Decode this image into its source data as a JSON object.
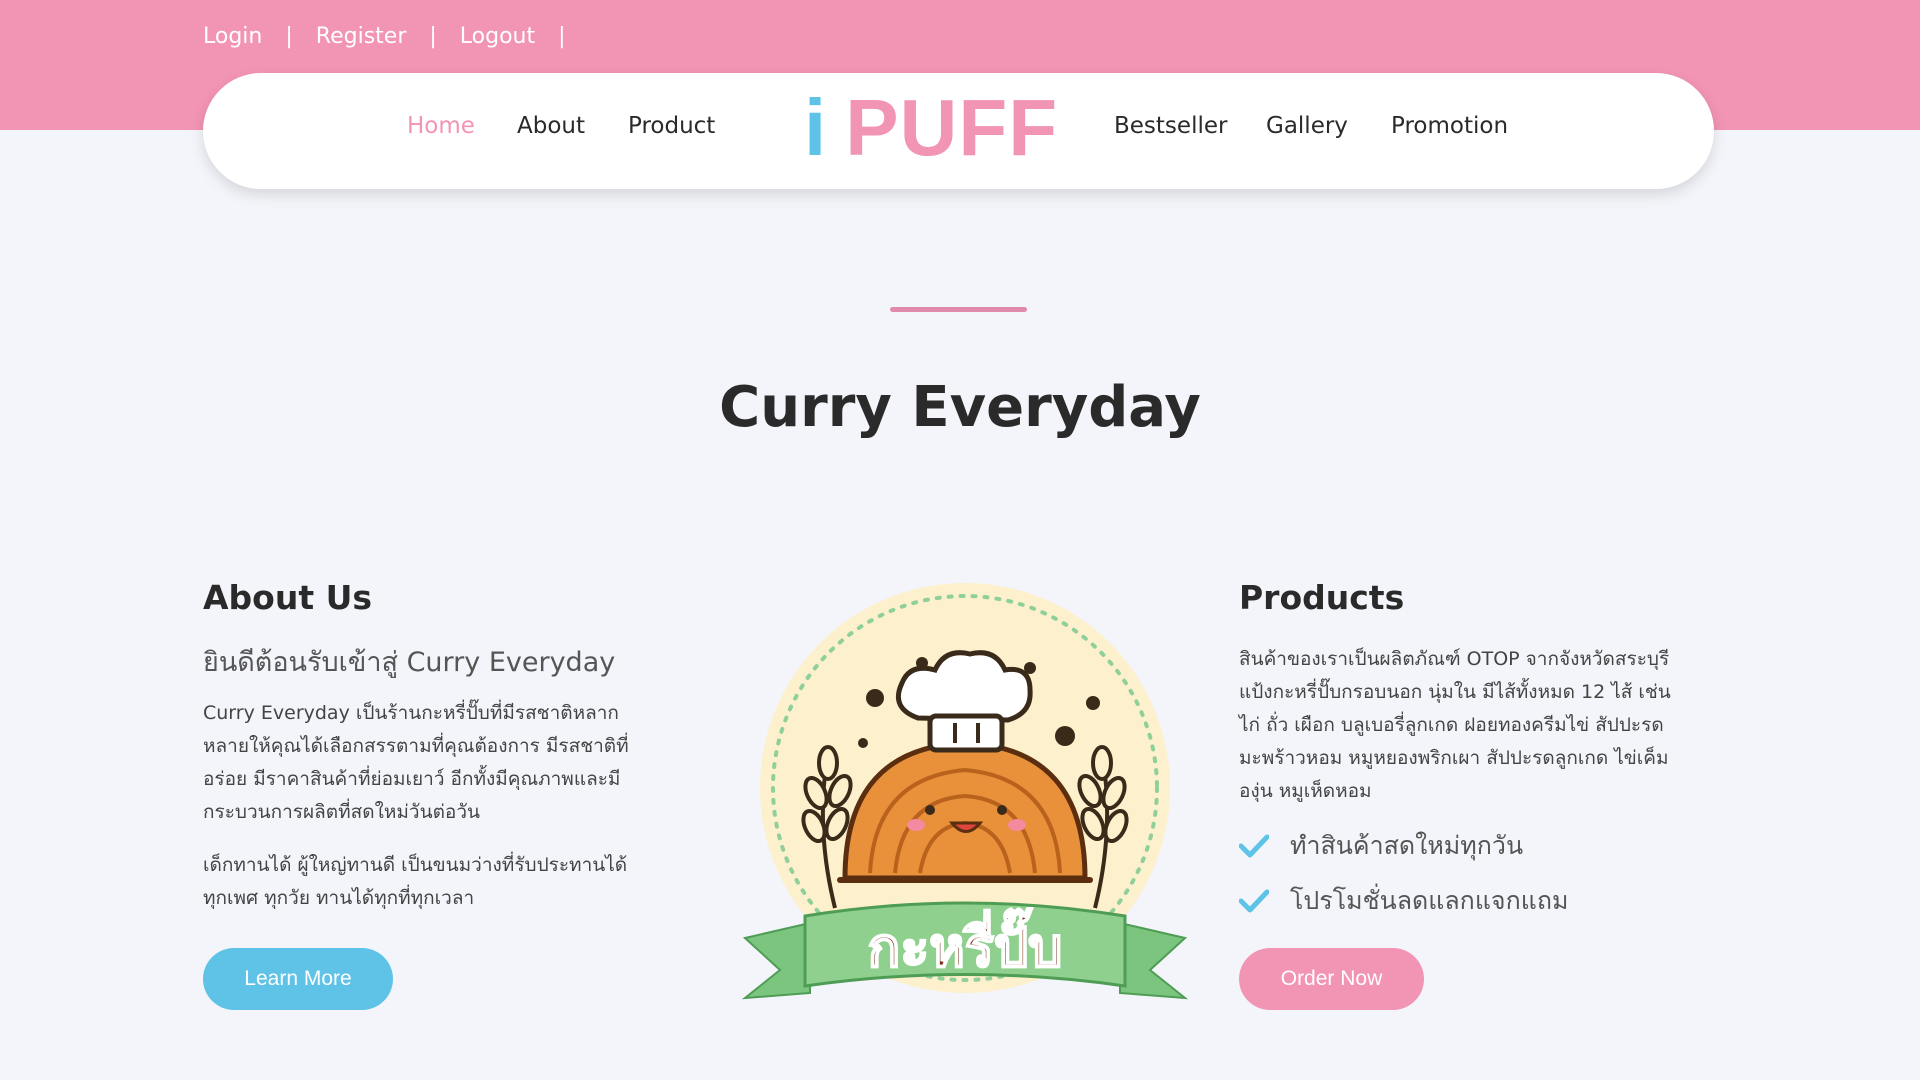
{
  "auth_links": [
    "Login",
    "Register",
    "Logout"
  ],
  "auth_separator": "|",
  "nav": {
    "home": "Home",
    "about": "About",
    "product": "Product",
    "bestseller": "Bestseller",
    "gallery": "Gallery",
    "promotion": "Promotion",
    "active": "Home"
  },
  "logo": {
    "i": "i",
    "puff": "PUFF"
  },
  "hero": {
    "title": "Curry Everyday"
  },
  "about": {
    "title": "About Us",
    "subtitle": "ยินดีต้อนรับเข้าสู่ Curry Everyday",
    "para1_lines": [
      "Curry Everyday เป็นร้านกะหรี่ปั๊บที่มีรสชาติหลาก",
      "หลายให้คุณได้เลือกสรรตามที่คุณต้องการ มีรสชาติที่",
      "อร่อย มีราคาสินค้าที่ย่อมเยาว์ อีกทั้งมีคุณภาพและมี",
      "กระบวนการผลิตที่สดใหม่วันต่อวัน"
    ],
    "para2_lines": [
      "เด็กทานได้ ผู้ใหญ่ทานดี เป็นขนมว่างที่รับประทานได้",
      "ทุกเพศ ทุกวัย ทานได้ทุกที่ทุกเวลา"
    ],
    "button": "Learn More"
  },
  "illustration": {
    "banner_text": "กะหรี่ปั๊บ"
  },
  "products": {
    "title": "Products",
    "desc_lines": [
      "สินค้าของเราเป็นผลิตภัณฑ์ OTOP จากจังหวัดสระบุรี",
      "แป้งกะหรี่ปั๊บกรอบนอก นุ่มใน มีไส้ทั้งหมด 12 ไส้ เช่น",
      "ไก่ ถั่ว เผือก บลูเบอรี่ลูกเกด ฝอยทองครีมไข่ สัปปะรด",
      "มะพร้าวหอม หมูหยองพริกเผา สัปปะรดลูกเกด ไข่เค็ม",
      "องุ่น หมูเห็ดหอม"
    ],
    "checks": [
      "ทำสินค้าสดใหม่ทุกวัน",
      "โปรโมชั่นลดแลกแจกแถม"
    ],
    "button": "Order Now"
  },
  "colors": {
    "brand_pink": "#f294b3",
    "brand_blue": "#5ec3e6",
    "background": "#f3f5fa"
  }
}
